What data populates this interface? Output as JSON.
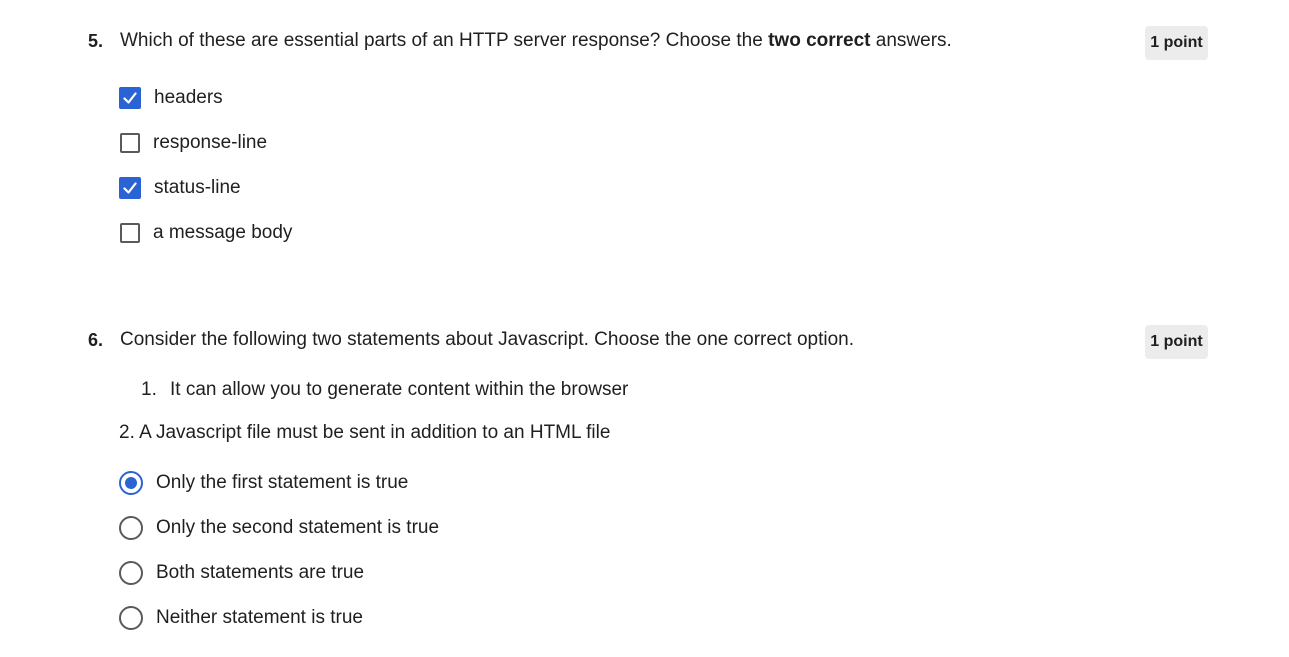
{
  "q5": {
    "number": "5.",
    "text_before": "Which of these are essential parts of an HTTP server response? Choose the ",
    "text_bold": "two correct",
    "text_after": " answers.",
    "points": "1 point",
    "options": [
      {
        "label": "headers",
        "checked": true
      },
      {
        "label": "response-line",
        "checked": false
      },
      {
        "label": "status-line",
        "checked": true
      },
      {
        "label": "a message body",
        "checked": false
      }
    ]
  },
  "q6": {
    "number": "6.",
    "text": "Consider the following two statements about Javascript. Choose the one correct option.",
    "points": "1 point",
    "statement_1_number": "1.",
    "statement_1_text": "It can allow you to generate content within the browser",
    "statement_2": "2. A Javascript file must be sent in addition to an HTML file",
    "options": [
      {
        "label": "Only the first statement is true",
        "selected": true
      },
      {
        "label": "Only the second statement is true",
        "selected": false
      },
      {
        "label": "Both statements are true",
        "selected": false
      },
      {
        "label": "Neither statement is true",
        "selected": false
      }
    ]
  },
  "colors": {
    "accent": "#2a63d4",
    "points_badge_bg": "#ececec",
    "control_border": "#5a5a5a"
  }
}
